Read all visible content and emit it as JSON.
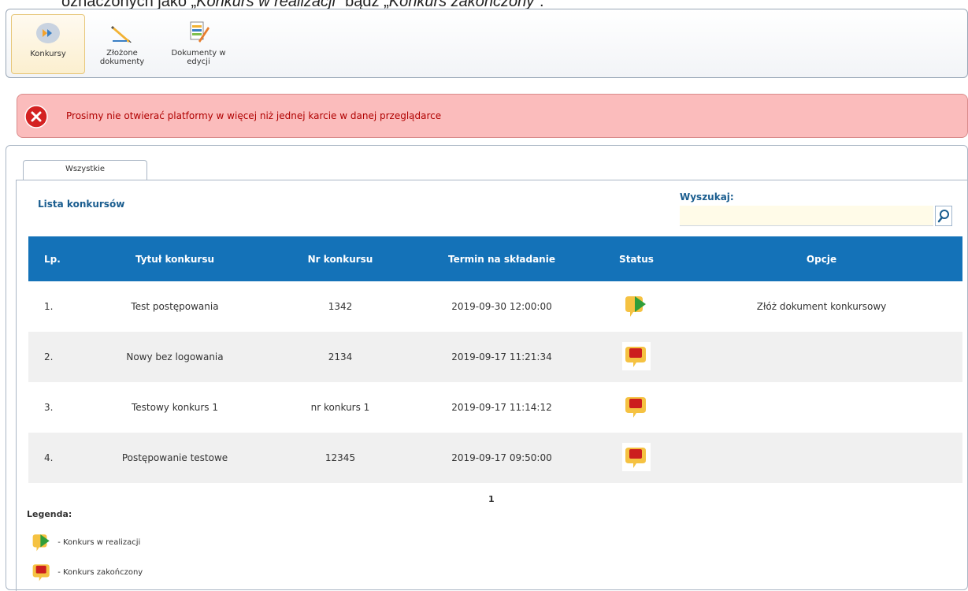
{
  "doc_caption": {
    "prefix": "oznaczonych jako „",
    "status1": "Konkurs w realizacji",
    "middle": "” bądź „",
    "status2": "Konkurs zakończony",
    "suffix": "”."
  },
  "toolbar": {
    "items": [
      {
        "label": "Konkursy",
        "icon": "arrows-icon"
      },
      {
        "label": "Złożone dokumenty",
        "icon": "pencil-icon"
      },
      {
        "label": "Dokumenty w edycji",
        "icon": "document-edit-icon"
      }
    ]
  },
  "alert": {
    "message": "Prosimy nie otwierać platformy w więcej niż jednej karcie w danej przeglądarce"
  },
  "tabs": [
    {
      "label": "Wszystkie"
    }
  ],
  "list": {
    "title": "Lista konkursów"
  },
  "search": {
    "label": "Wyszukaj:",
    "value": "",
    "placeholder": ""
  },
  "table": {
    "headers": [
      "Lp.",
      "Tytuł konkursu",
      "Nr konkursu",
      "Termin na składanie",
      "Status",
      "Opcje"
    ],
    "rows": [
      {
        "lp": "1.",
        "title": "Test postępowania",
        "number": "1342",
        "deadline": "2019-09-30 12:00:00",
        "status": "in-progress",
        "option": "Złóż dokument konkursowy"
      },
      {
        "lp": "2.",
        "title": "Nowy bez logowania",
        "number": "2134",
        "deadline": "2019-09-17 11:21:34",
        "status": "finished",
        "option": ""
      },
      {
        "lp": "3.",
        "title": "Testowy konkurs 1",
        "number": "nr konkurs 1",
        "deadline": "2019-09-17 11:14:12",
        "status": "finished",
        "option": ""
      },
      {
        "lp": "4.",
        "title": "Postępowanie testowe",
        "number": "12345",
        "deadline": "2019-09-17 09:50:00",
        "status": "finished",
        "option": ""
      }
    ]
  },
  "pager": {
    "current": "1"
  },
  "legend": {
    "title": "Legenda:",
    "items": [
      {
        "label": "- Konkurs w realizacji",
        "icon": "status-in-progress-icon"
      },
      {
        "label": "- Konkurs zakończony",
        "icon": "status-finished-icon"
      }
    ]
  },
  "colors": {
    "header_bg": "#1472b8",
    "alert_bg": "#fbbcbc",
    "alert_text": "#b00000",
    "title_blue": "#1a5d8f"
  }
}
